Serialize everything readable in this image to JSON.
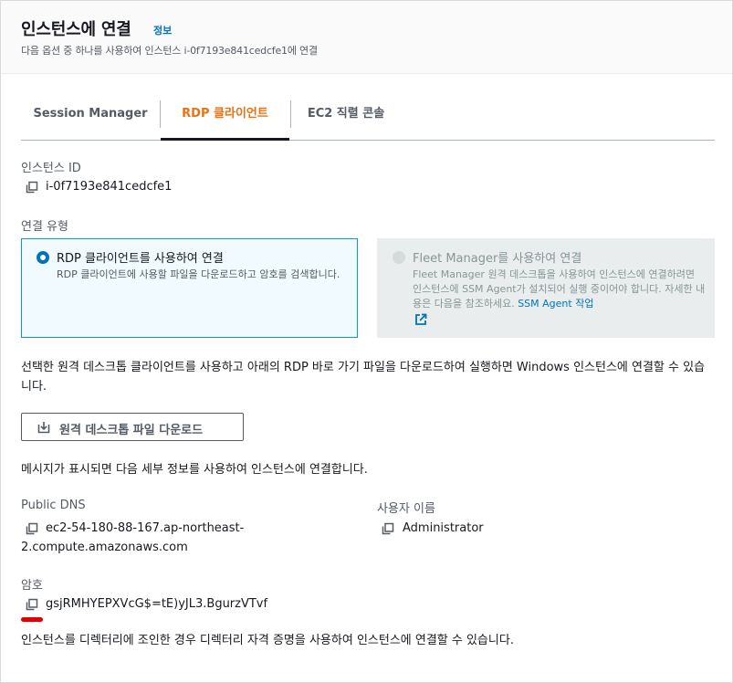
{
  "header": {
    "title": "인스턴스에 연결",
    "info_link": "정보",
    "subtitle": "다음 옵션 중 하나를 사용하여 인스턴스 i-0f7193e841cedcfe1에 연결"
  },
  "tabs": [
    {
      "label": "Session Manager"
    },
    {
      "label": "RDP 클라이언트"
    },
    {
      "label": "EC2 직렬 콘솔"
    }
  ],
  "instance": {
    "label": "인스턴스 ID",
    "value": "i-0f7193e841cedcfe1"
  },
  "connection_type": {
    "label": "연결 유형",
    "rdp_option": {
      "title": "RDP 클라이언트를 사용하여 연결",
      "desc": "RDP 클라이언트에 사용할 파일을 다운로드하고 암호를 검색합니다."
    },
    "fleet_option": {
      "title": "Fleet Manager를 사용하여 연결",
      "desc": "Fleet Manager 원격 데스크톱을 사용하여 인스턴스에 연결하려면 인스턴스에 SSM Agent가 설치되어 실행 중이어야 합니다. 자세한 내용은 다음을 참조하세요. ",
      "link": "SSM Agent 작업"
    }
  },
  "instructions": {
    "download_desc": "선택한 원격 데스크톱 클라이언트를 사용하고 아래의 RDP 바로 가기 파일을 다운로드하여 실행하면 Windows 인스턴스에 연결할 수 있습니다.",
    "download_button": "원격 데스크톱 파일 다운로드",
    "prompt_desc": "메시지가 표시되면 다음 세부 정보를 사용하여 인스턴스에 연결합니다.",
    "domain_desc": "인스턴스를 디렉터리에 조인한 경우 디렉터리 자격 증명을 사용하여 인스턴스에 연결할 수 있습니다."
  },
  "details": {
    "public_dns_label": "Public DNS",
    "public_dns_line1": "ec2-54-180-88-167.ap-northeast-",
    "public_dns_line2": "2.compute.amazonaws.com",
    "username_label": "사용자 이름",
    "username_value": "Administrator",
    "password_label": "암호",
    "password_value": "gsjRMHYEPXVcG$=tE)yJL3.BgurzVTvf"
  },
  "colors": {
    "accent_orange": "#ec7211",
    "link_blue": "#0073bb",
    "selected_border": "#00a1c9",
    "annotation_red": "#e00000"
  },
  "icons": [
    "copy-icon",
    "external-link-icon",
    "download-icon"
  ]
}
